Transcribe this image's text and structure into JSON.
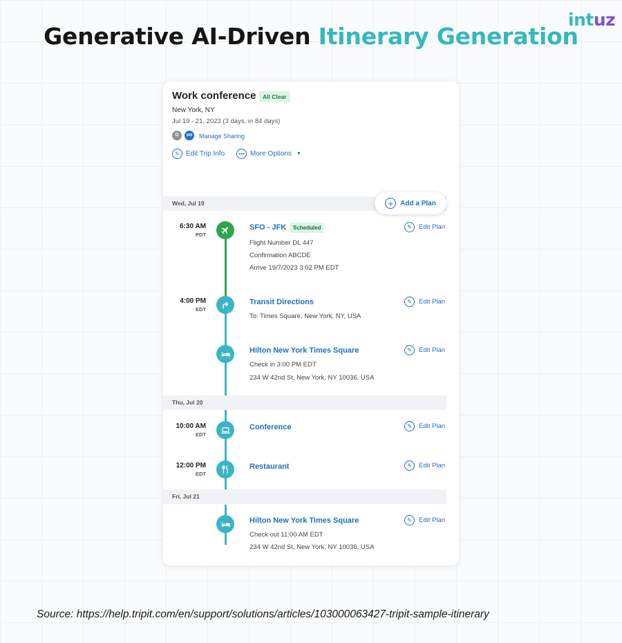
{
  "header": {
    "title_dark": "Generative AI-Driven ",
    "title_accent": "Itinerary Generation",
    "logo_part1": "int",
    "logo_part2": "uz"
  },
  "trip": {
    "title": "Work conference",
    "status": "All Clear",
    "city": "New York, NY",
    "dates": "Jul 19 - 21, 2023 (3 days, in 84 days)",
    "avatar1": "G",
    "avatar2": "oo",
    "manage_sharing": "Manage Sharing",
    "edit_trip_info": "Edit Trip Info",
    "more_options": "More Options",
    "add_plan": "Add a Plan"
  },
  "days": [
    {
      "label": "Wed, Jul 19"
    },
    {
      "label": "Thu, Jul 20"
    },
    {
      "label": "Fri, Jul 21"
    }
  ],
  "plans": [
    {
      "time": "6:30 AM",
      "zone": "PDT",
      "title": "SFO - JFK",
      "badge": "Scheduled",
      "icon": "airplane-icon",
      "details": [
        "Flight Number DL 447",
        "Confirmation ABCDE",
        "Arrive 19/7/2023 3:02 PM EDT"
      ],
      "edit": "Edit Plan"
    },
    {
      "time": "4:00 PM",
      "zone": "EDT",
      "title": "Transit Directions",
      "icon": "directions-icon",
      "details": [
        "To: Times Square, New York, NY, USA"
      ],
      "edit": "Edit Plan"
    },
    {
      "title": "Hilton New York Times Square",
      "icon": "bed-icon",
      "details": [
        "Check in 3:00 PM EDT",
        "234 W 42nd St, New York, NY 10036, USA"
      ],
      "edit": "Edit Plan"
    },
    {
      "time": "10:00 AM",
      "zone": "EDT",
      "title": "Conference",
      "icon": "laptop-icon",
      "details": [],
      "edit": "Edit Plan"
    },
    {
      "time": "12:00 PM",
      "zone": "EDT",
      "title": "Restaurant",
      "icon": "utensils-icon",
      "details": [],
      "edit": "Edit Plan"
    },
    {
      "title": "Hilton New York Times Square",
      "icon": "bed-icon",
      "details": [
        "Check out 11:00 AM EDT",
        "234 W 42nd St, New York, NY 10036, USA"
      ],
      "edit": "Edit Plan"
    }
  ],
  "colors": {
    "accent": "#35b8bf",
    "link": "#1f6fbf",
    "flight_green": "#2fa552",
    "timeline_teal": "#3ab4c7"
  },
  "footer": {
    "source": "Source:  https://help.tripit.com/en/support/solutions/articles/103000063427-tripit-sample-itinerary"
  }
}
